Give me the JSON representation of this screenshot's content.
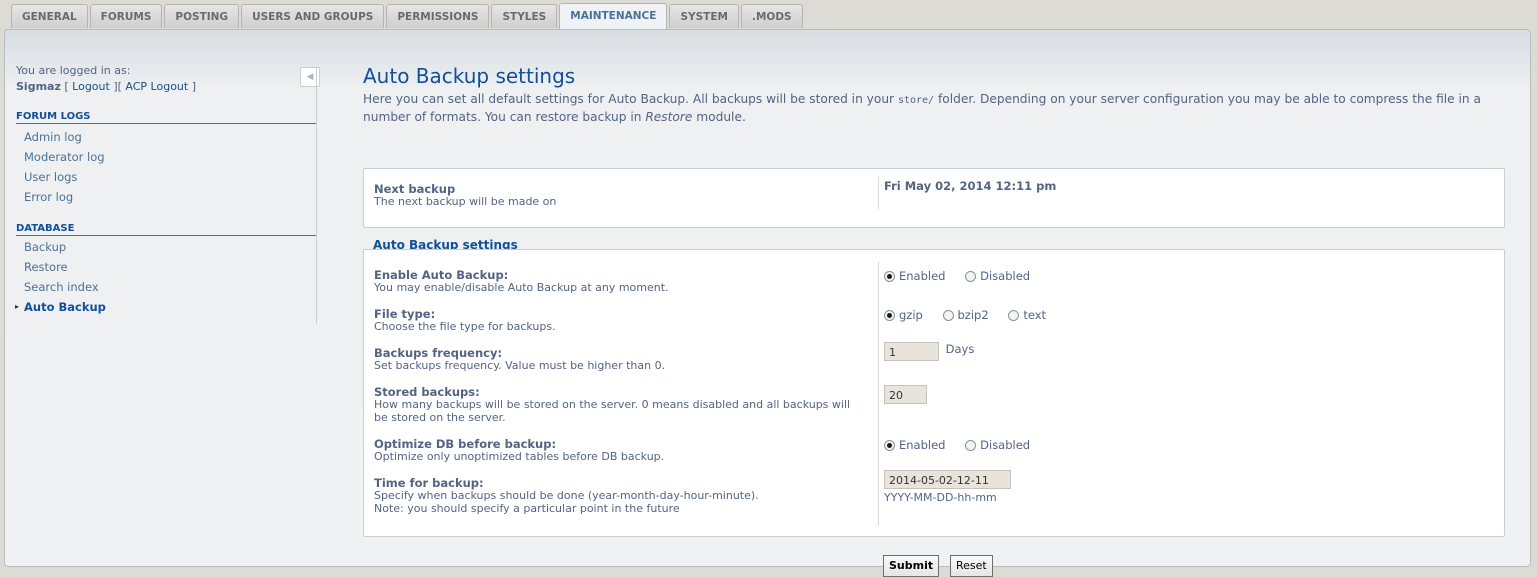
{
  "tabs": [
    "GENERAL",
    "FORUMS",
    "POSTING",
    "USERS AND GROUPS",
    "PERMISSIONS",
    "STYLES",
    "MAINTENANCE",
    "SYSTEM",
    ".MODS"
  ],
  "active_tab": "MAINTENANCE",
  "sidebar": {
    "logged_in_as": "You are logged in as:",
    "username": "Sigmaz",
    "logout": "Logout",
    "acp_logout": "ACP Logout",
    "sections": [
      {
        "title": "FORUM LOGS",
        "items": [
          "Admin log",
          "Moderator log",
          "User logs",
          "Error log"
        ]
      },
      {
        "title": "DATABASE",
        "items": [
          "Backup",
          "Restore",
          "Search index",
          "Auto Backup"
        ]
      }
    ],
    "active_item": "Auto Backup"
  },
  "main": {
    "title": "Auto Backup settings",
    "intro_1": "Here you can set all default settings for Auto Backup. All backups will be stored in your ",
    "intro_code": "store/",
    "intro_2": " folder. Depending on your server configuration you may be able to compress the file in a number of formats. You can restore backup in ",
    "intro_em": "Restore",
    "intro_3": " module.",
    "next_backup": {
      "title": "Next backup",
      "desc": "The next backup will be made on",
      "value": "Fri May 02, 2014 12:11 pm"
    },
    "settings_legend": "Auto Backup settings",
    "enable": {
      "title": "Enable Auto Backup:",
      "desc": "You may enable/disable Auto Backup at any moment.",
      "options": [
        "Enabled",
        "Disabled"
      ],
      "selected": "Enabled"
    },
    "file_type": {
      "title": "File type:",
      "desc": "Choose the file type for backups.",
      "options": [
        "gzip",
        "bzip2",
        "text"
      ],
      "selected": "gzip"
    },
    "frequency": {
      "title": "Backups frequency:",
      "desc": "Set backups frequency. Value must be higher than 0.",
      "value": "1",
      "unit": "Days"
    },
    "stored": {
      "title": "Stored backups:",
      "desc_1": "How many backups will be stored on the server. 0 means disabled and all backups will",
      "desc_2": "be stored on the server.",
      "value": "20"
    },
    "optimize": {
      "title": "Optimize DB before backup:",
      "desc": "Optimize only unoptimized tables before DB backup.",
      "options": [
        "Enabled",
        "Disabled"
      ],
      "selected": "Enabled"
    },
    "time": {
      "title": "Time for backup:",
      "desc_1": "Specify when backups should be done (year-month-day-hour-minute).",
      "desc_2": "Note: you should specify a particular point in the future",
      "value": "2014-05-02-12-11",
      "format": "YYYY-MM-DD-hh-mm"
    },
    "submit": "Submit",
    "reset": "Reset"
  }
}
